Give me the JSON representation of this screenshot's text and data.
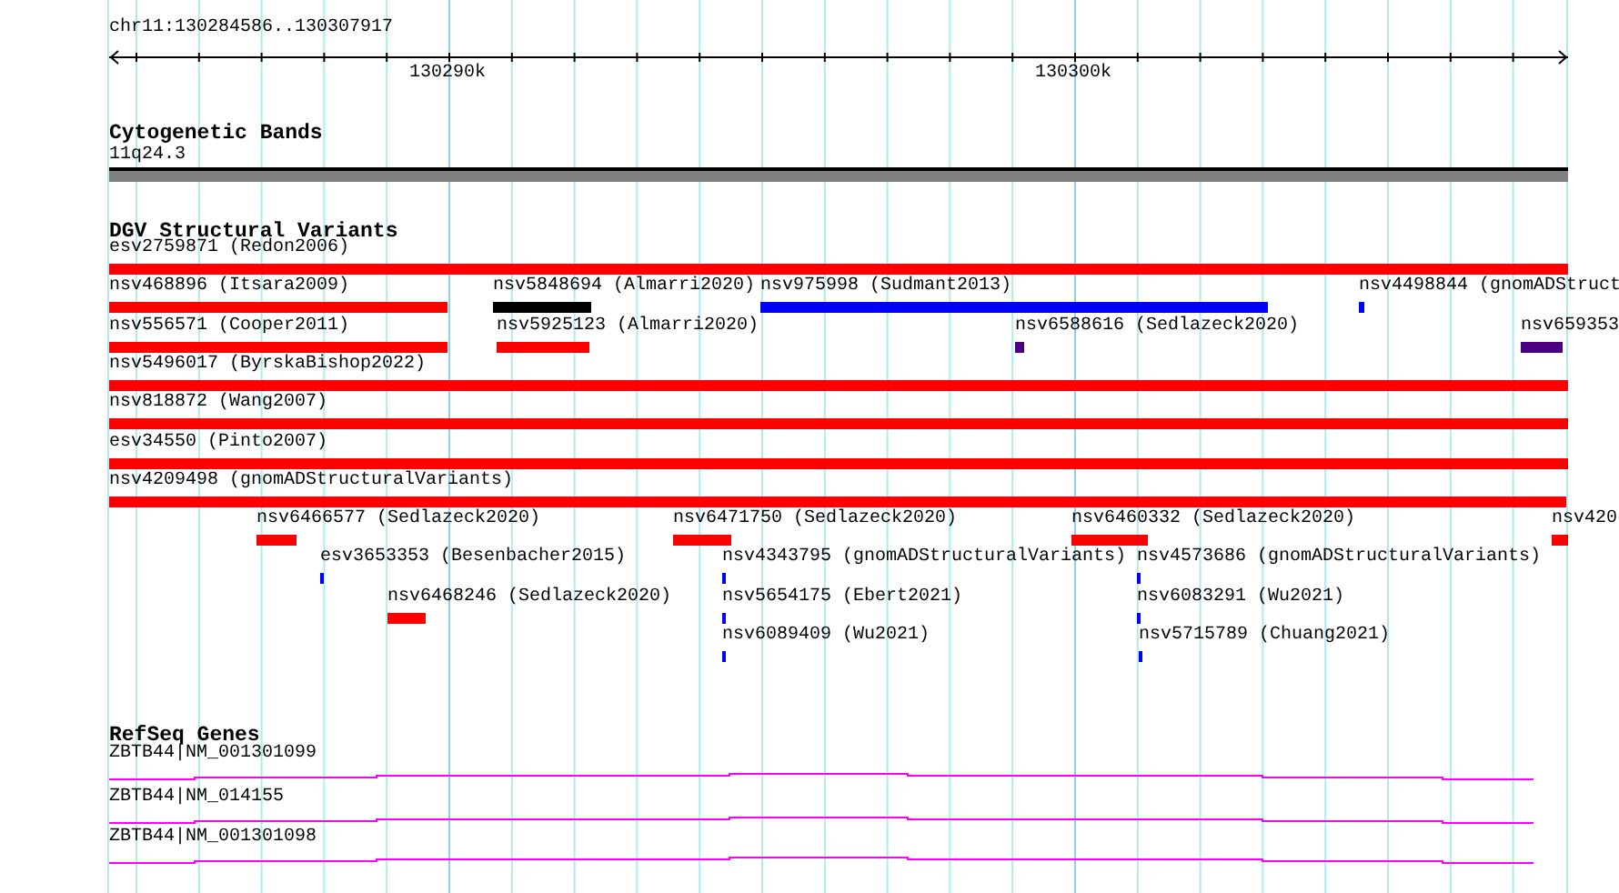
{
  "ruler": {
    "region": "chr11:130284586..130307917",
    "ticks": [
      "130290k",
      "130300k"
    ]
  },
  "tracks": [
    {
      "kind": "cytoband",
      "title": "Cytogenetic Bands",
      "band": "11q24.3"
    },
    {
      "kind": "variants",
      "title": "DGV Structural Variants",
      "features": [
        {
          "label": "esv2759871 (Redon2006)",
          "color": "#ff0000"
        },
        {
          "label": "nsv468896 (Itsara2009)",
          "color": "#ff0000"
        },
        {
          "label": "nsv5848694 (Almarri2020)",
          "color": "#000000"
        },
        {
          "label": "nsv975998 (Sudmant2013)",
          "color": "#0000ff"
        },
        {
          "label": "nsv4498844 (gnomADStruct",
          "color": "#0000ff"
        },
        {
          "label": "nsv556571 (Cooper2011)",
          "color": "#ff0000"
        },
        {
          "label": "nsv5925123 (Almarri2020)",
          "color": "#ff0000"
        },
        {
          "label": "nsv6588616 (Sedlazeck2020)",
          "color": "#4b0082"
        },
        {
          "label": "nsv659353",
          "color": "#4b0082"
        },
        {
          "label": "nsv5496017 (ByrskaBishop2022)",
          "color": "#ff0000"
        },
        {
          "label": "nsv818872 (Wang2007)",
          "color": "#ff0000"
        },
        {
          "label": "esv34550 (Pinto2007)",
          "color": "#ff0000"
        },
        {
          "label": "nsv4209498 (gnomADStructuralVariants)",
          "color": "#ff0000"
        },
        {
          "label": "nsv6466577 (Sedlazeck2020)",
          "color": "#ff0000"
        },
        {
          "label": "nsv6471750 (Sedlazeck2020)",
          "color": "#ff0000"
        },
        {
          "label": "nsv6460332 (Sedlazeck2020)",
          "color": "#ff0000"
        },
        {
          "label": "nsv420",
          "color": "#ff0000"
        },
        {
          "label": "esv3653353 (Besenbacher2015)",
          "color": "#0000ff"
        },
        {
          "label": "nsv4343795 (gnomADStructuralVariants)",
          "color": "#0000ff"
        },
        {
          "label": "nsv4573686 (gnomADStructuralVariants)",
          "color": "#0000ff"
        },
        {
          "label": "nsv6468246 (Sedlazeck2020)",
          "color": "#ff0000"
        },
        {
          "label": "nsv5654175 (Ebert2021)",
          "color": "#0000ff"
        },
        {
          "label": "nsv6083291 (Wu2021)",
          "color": "#0000ff"
        },
        {
          "label": "nsv6089409 (Wu2021)",
          "color": "#0000ff"
        },
        {
          "label": "nsv5715789 (Chuang2021)",
          "color": "#0000ff"
        }
      ]
    },
    {
      "kind": "genes",
      "title": "RefSeq Genes",
      "genes": [
        "ZBTB44|NM_001301099",
        "ZBTB44|NM_014155",
        "ZBTB44|NM_001301098"
      ]
    }
  ]
}
